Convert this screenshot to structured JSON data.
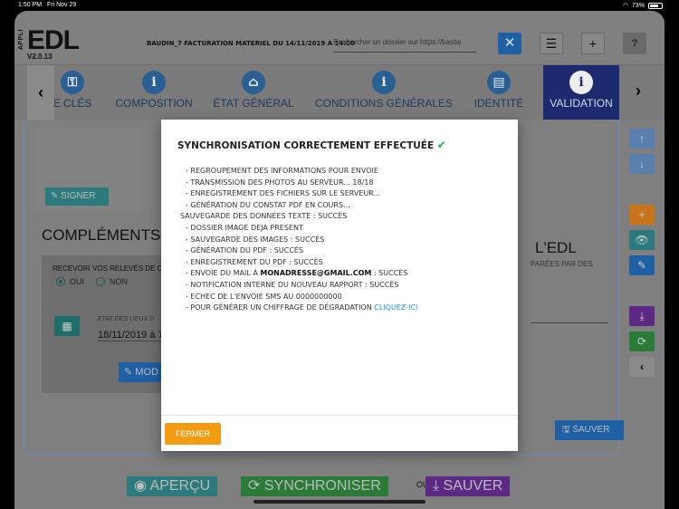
{
  "status_bar": {
    "time": "1:50 PM",
    "date": "Fri Nov 29",
    "battery": "73%",
    "battery_level": 0.73
  },
  "header": {
    "logo_prefix": "APPLI",
    "logo": "EDL",
    "version": "V2.0.13",
    "title": "BAUDIN_7 FACTURATION MATERIEL DU 14/11/2019 À 14:00",
    "search_placeholder": "Rechercher un dossier sur https://bastie",
    "close_icon": "✕",
    "menu_icon": "☰",
    "add_icon": "+",
    "help_icon": "?"
  },
  "tabs": {
    "prev_icon": "‹",
    "next_icon": "›",
    "items": [
      {
        "label": "E CLÉS",
        "icon": "key-icon",
        "glyph": "⚿",
        "active": false
      },
      {
        "label": "COMPOSITION",
        "icon": "info-icon",
        "glyph": "i",
        "active": false
      },
      {
        "label": "ÉTAT GÉNÉRAL",
        "icon": "home-icon",
        "glyph": "⌂",
        "active": false
      },
      {
        "label": "CONDITIONS GÉNÉRALES",
        "icon": "info-icon",
        "glyph": "i",
        "active": false
      },
      {
        "label": "IDENTITÉ",
        "icon": "document-icon",
        "glyph": "▤",
        "active": false
      },
      {
        "label": "VALIDATION",
        "icon": "info-icon",
        "glyph": "i",
        "active": true
      }
    ]
  },
  "background": {
    "signer_label": "SIGNER",
    "section_title": "COMPLÉMENTS",
    "right_section_title": "L'EDL",
    "right_sub": "PARÉES PAR DES",
    "releves_label": "RECEVOIR VOS RELEVÉS DE C",
    "radio_yes": "OUI",
    "radio_no": "NON",
    "etat_label": "ETAT DES LIEUX D",
    "etat_value": "18/11/2019 à 7",
    "modifier_label": "MOD",
    "sauver_small": "SAUVER"
  },
  "side_buttons": [
    {
      "name": "move-up",
      "glyph": "↑",
      "color": "#5a7fae"
    },
    {
      "name": "move-down",
      "glyph": "↓",
      "color": "#5a7fae"
    },
    {
      "name": "add",
      "glyph": "+",
      "color": "#c8741a"
    },
    {
      "name": "view",
      "glyph": "👁",
      "color": "#2b7a7c"
    },
    {
      "name": "edit",
      "glyph": "✎",
      "color": "#1f5fa3"
    },
    {
      "name": "download",
      "glyph": "⤓",
      "color": "#5c2a84"
    },
    {
      "name": "sync",
      "glyph": "⟳",
      "color": "#2a7a38"
    },
    {
      "name": "collapse",
      "glyph": "‹",
      "color": "#8a8a8a"
    }
  ],
  "bottom": {
    "apercu": "APERÇU",
    "synchroniser": "SYNCHRONISER",
    "ou": "OU",
    "sauver": "SAUVER"
  },
  "modal": {
    "title": "SYNCHRONISATION CORRECTEMENT EFFECTUÉE",
    "title_icon": "✔",
    "lines": [
      "- REGROUPEMENT DES INFORMATIONS POUR ENVOIE",
      "- TRANSMISSION DES PHOTOS AU SERVEUR... 18/18",
      "- ENREGISTREMENT DES FICHIERS SUR LE SERVEUR...",
      "- GÉNÉRATION DU CONSTAT PDF EN COURS...",
      "SAUVEGARDE DES DONNÉES TEXTE : SUCCÈS",
      "- DOSSIER IMAGE DEJA PRESENT",
      "- SAUVEGARDE DES IMAGES : SUCCÈS",
      "- GÉNÉRATION DU PDF : SUCCÈS",
      "- ENREGISTREMENT DU PDF : SUCCÈS"
    ],
    "mail_line": {
      "prefix": "- ENVOIE DU MAIL À ",
      "email": "MONADRESSE@GMAIL.COM",
      "suffix": " : SUCCÈS"
    },
    "lines_after": [
      "- NOTIFICATION INTERNE DU NOUVEAU RAPPORT : SUCCÈS",
      "- ECHEC DE L'ENVOIE SMS AU 0000000000"
    ],
    "link_line": {
      "prefix": "- POUR GÉNÉRER UN CHIFFRAGE DE DÉGRADATION ",
      "link": "CLIQUEZ-ICI"
    },
    "close_button": "FERMER"
  }
}
